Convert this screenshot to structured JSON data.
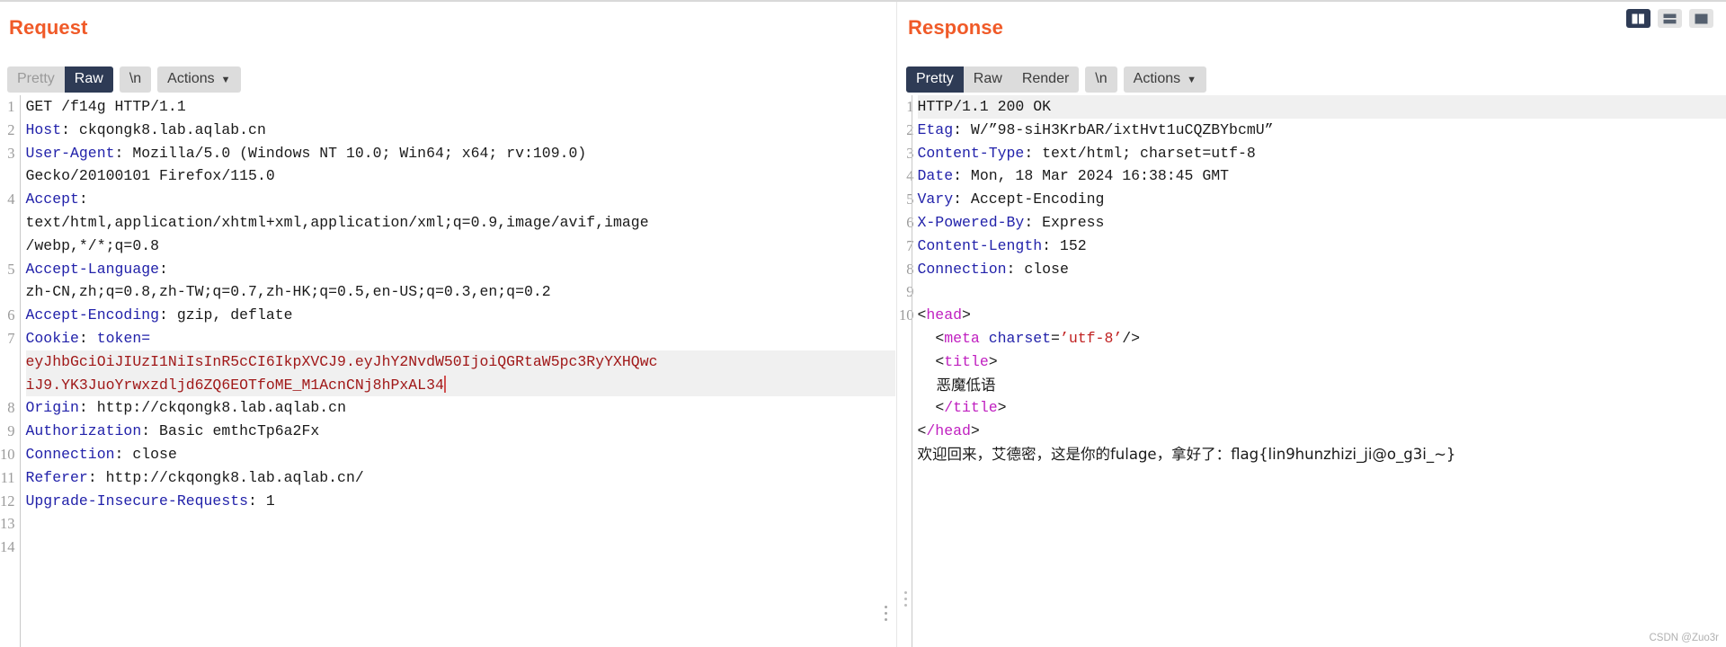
{
  "layout_buttons": [
    {
      "name": "split-vertical",
      "active": true
    },
    {
      "name": "split-horizontal",
      "active": false
    },
    {
      "name": "single-pane",
      "active": false
    }
  ],
  "request": {
    "title": "Request",
    "tabs": [
      {
        "label": "Pretty",
        "active": false,
        "muted": true
      },
      {
        "label": "Raw",
        "active": true,
        "muted": false
      }
    ],
    "newline_label": "\\n",
    "actions_label": "Actions",
    "actions_caret": "⌄",
    "line_numbers": [
      "1",
      "2",
      "3",
      "",
      "4",
      "",
      "",
      "5",
      "",
      "6",
      "7",
      "",
      "",
      "8",
      "9",
      "10",
      "11",
      "12",
      "13",
      "14"
    ],
    "lines": [
      {
        "type": "plain",
        "text": "GET /f14g HTTP/1.1"
      },
      {
        "type": "header",
        "name": "Host",
        "value": " ckqongk8.lab.aqlab.cn"
      },
      {
        "type": "header",
        "name": "User-Agent",
        "value": " Mozilla/5.0 (Windows NT 10.0; Win64; x64; rv:109.0)"
      },
      {
        "type": "plain",
        "text": "Gecko/20100101 Firefox/115.0"
      },
      {
        "type": "header",
        "name": "Accept",
        "value": ""
      },
      {
        "type": "plain",
        "text": "text/html,application/xhtml+xml,application/xml;q=0.9,image/avif,image"
      },
      {
        "type": "plain",
        "text": "/webp,*/*;q=0.8"
      },
      {
        "type": "header",
        "name": "Accept-Language",
        "value": ""
      },
      {
        "type": "plain",
        "text": "zh-CN,zh;q=0.8,zh-TW;q=0.7,zh-HK;q=0.5,en-US;q=0.3,en;q=0.2"
      },
      {
        "type": "header",
        "name": "Accept-Encoding",
        "value": " gzip, deflate"
      },
      {
        "type": "cookie",
        "name": "Cookie",
        "value": " token="
      },
      {
        "type": "token",
        "text": "eyJhbGciOiJIUzI1NiIsInR5cCI6IkpXVCJ9.eyJhY2NvdW50IjoiQGRtaW5pc3RyYXHQwc"
      },
      {
        "type": "token-caret",
        "text": "iJ9.YK3JuoYrwxzdljd6ZQ6EOTfoME_M1AcnCNj8hPxAL34"
      },
      {
        "type": "header",
        "name": "Origin",
        "value": " http://ckqongk8.lab.aqlab.cn"
      },
      {
        "type": "header",
        "name": "Authorization",
        "value": " Basic emthcTp6a2Fx"
      },
      {
        "type": "header",
        "name": "Connection",
        "value": " close"
      },
      {
        "type": "header",
        "name": "Referer",
        "value": " http://ckqongk8.lab.aqlab.cn/"
      },
      {
        "type": "header",
        "name": "Upgrade-Insecure-Requests",
        "value": " 1"
      },
      {
        "type": "blank",
        "text": ""
      },
      {
        "type": "blank",
        "text": ""
      }
    ]
  },
  "response": {
    "title": "Response",
    "tabs": [
      {
        "label": "Pretty",
        "active": true,
        "muted": false
      },
      {
        "label": "Raw",
        "active": false,
        "muted": false
      },
      {
        "label": "Render",
        "active": false,
        "muted": false
      }
    ],
    "newline_label": "\\n",
    "actions_label": "Actions",
    "actions_caret": "⌄",
    "line_numbers": [
      "1",
      "2",
      "3",
      "4",
      "5",
      "6",
      "7",
      "8",
      "9",
      "10",
      "",
      "",
      "",
      "",
      "",
      ""
    ],
    "lines": [
      {
        "type": "status",
        "text": "HTTP/1.1 200 OK"
      },
      {
        "type": "header",
        "name": "Etag",
        "value": " W/”98-siH3KrbAR/ixtHvt1uCQZBYbcmU”"
      },
      {
        "type": "header",
        "name": "Content-Type",
        "value": " text/html; charset=utf-8"
      },
      {
        "type": "header",
        "name": "Date",
        "value": " Mon, 18 Mar 2024 16:38:45 GMT"
      },
      {
        "type": "header",
        "name": "Vary",
        "value": " Accept-Encoding"
      },
      {
        "type": "header",
        "name": "X-Powered-By",
        "value": " Express"
      },
      {
        "type": "header",
        "name": "Content-Length",
        "value": " 152"
      },
      {
        "type": "header",
        "name": "Connection",
        "value": " close"
      },
      {
        "type": "blank",
        "text": ""
      },
      {
        "type": "tag-open",
        "text": "<head>"
      },
      {
        "type": "meta",
        "text": "  <meta charset='utf-8'/>"
      },
      {
        "type": "tag-title-open",
        "text": "  <title>"
      },
      {
        "type": "cjk",
        "text": "    恶魔低语"
      },
      {
        "type": "tag-title-close",
        "text": "  </title>"
      },
      {
        "type": "tag-close",
        "text": "</head>"
      },
      {
        "type": "flagline",
        "text": "欢迎回来，艾德密，这是你的fulage，拿好了：flag{lin9hunzhizi_ji@o_g3i_~}"
      }
    ]
  },
  "watermark": "CSDN @Zuo3r",
  "colors": {
    "accent": "#f05a28",
    "header_key": "#2222aa",
    "token": "#a01818",
    "tag": "#c020c0",
    "attr_value": "#c02020",
    "active_tab_bg": "#2e3b55"
  }
}
